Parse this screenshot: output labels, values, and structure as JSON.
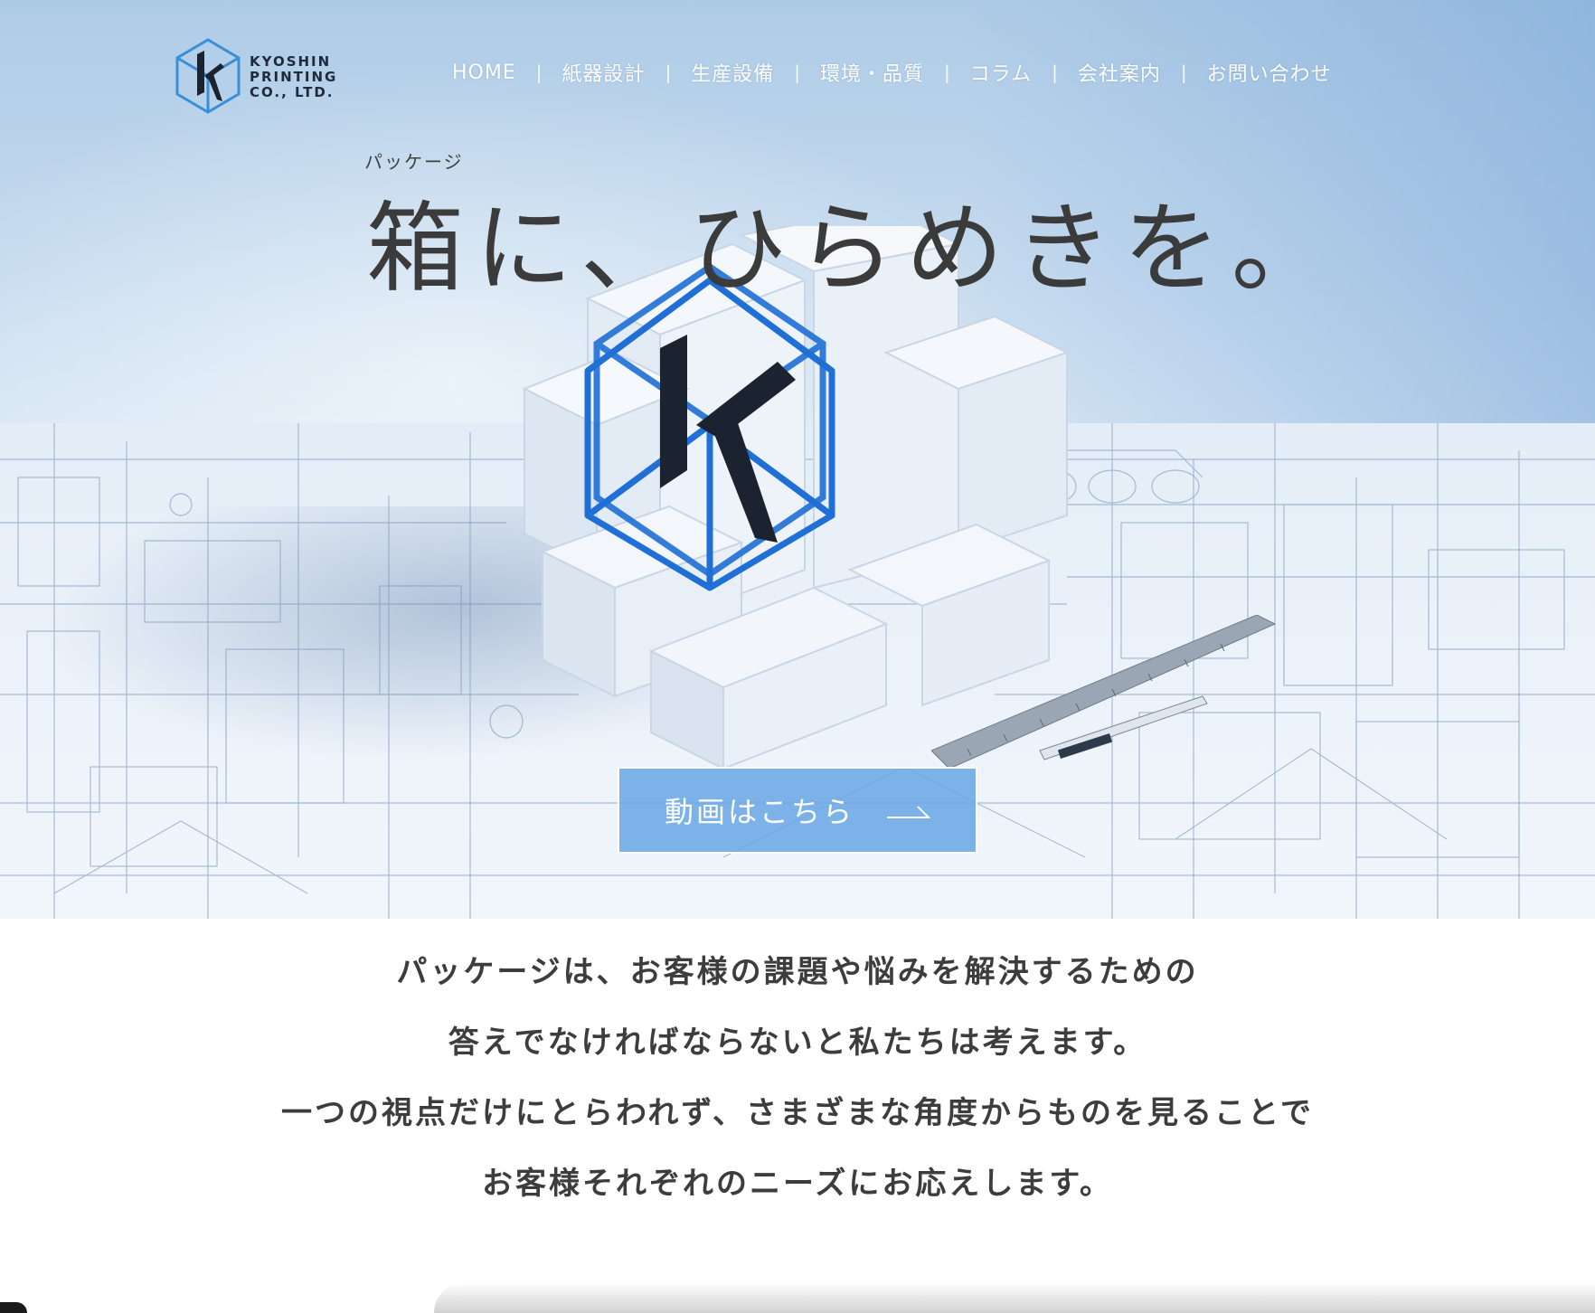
{
  "brand": {
    "line1": "KYOSHIN",
    "line2": "PRINTING",
    "line3": "CO., LTD."
  },
  "nav": {
    "items": [
      "HOME",
      "紙器設計",
      "生産設備",
      "環境・品質",
      "コラム",
      "会社案内",
      "お問い合わせ"
    ],
    "separator": "|"
  },
  "hero": {
    "ruby": "パッケージ",
    "headline": "箱に、ひらめきを。"
  },
  "cta": {
    "label": "動画はこちら"
  },
  "intro": {
    "lines": [
      "パッケージは、お客様の課題や悩みを解決するための",
      "答えでなければならないと私たちは考えます。",
      "一つの視点だけにとらわれず、さまざまな角度からものを見ることで",
      "お客様それぞれのニーズにお応えします。"
    ]
  },
  "colors": {
    "accent": "#6ca8e4",
    "logo_blue": "#3a8fd8",
    "cube_blue": "#1f6fd6",
    "text_dark": "#3b3b3b"
  },
  "icons": [
    "kyoshin-logo-icon",
    "arrow-right-icon"
  ]
}
